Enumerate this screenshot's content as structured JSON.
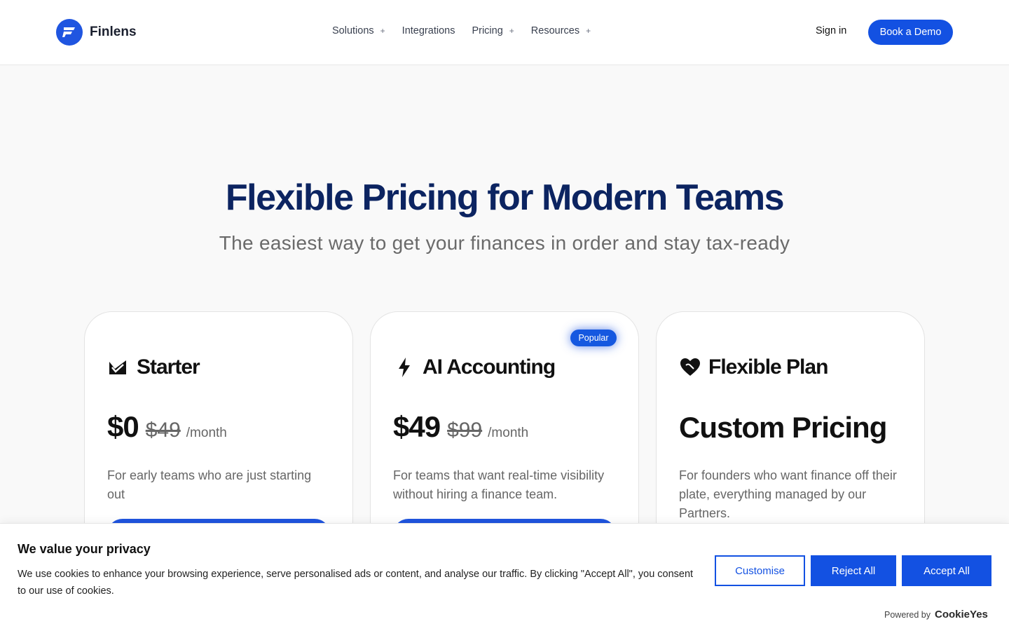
{
  "header": {
    "brand": "Finlens",
    "nav": [
      {
        "label": "Solutions",
        "has_menu": true
      },
      {
        "label": "Integrations",
        "has_menu": false
      },
      {
        "label": "Pricing",
        "has_menu": true
      },
      {
        "label": "Resources",
        "has_menu": true
      }
    ],
    "menu_symbol": "+",
    "sign_in": "Sign in",
    "cta": "Book a Demo"
  },
  "hero": {
    "title": "Flexible Pricing for Modern Teams",
    "subtitle": "The easiest way to get your finances in order and stay tax-ready"
  },
  "plans": [
    {
      "name": "Starter",
      "icon": "starter-check-icon",
      "price": "$0",
      "old_price": "$49",
      "period": "/month",
      "description": "For early teams who are just starting out"
    },
    {
      "name": "AI Accounting",
      "icon": "lightning-bolt-icon",
      "badge": "Popular",
      "price": "$49",
      "old_price": "$99",
      "period": "/month",
      "description": "For teams that want real-time visibility without hiring a finance team."
    },
    {
      "name": "Flexible Plan",
      "icon": "heart-icon",
      "price": "Custom Pricing",
      "description": "For founders who want finance off their plate,  everything managed by our Partners."
    }
  ],
  "cookie": {
    "title": "We value your privacy",
    "text": "We use cookies to enhance your browsing experience, serve personalised ads or content, and analyse our traffic. By clicking \"Accept All\", you consent to our use of cookies.",
    "customise": "Customise",
    "reject": "Reject All",
    "accept": "Accept All",
    "powered_by": "Powered by",
    "powered_brand": "CookieYes"
  },
  "colors": {
    "accent": "#1351e2",
    "heading": "#0c2461",
    "muted_text": "#666666"
  }
}
